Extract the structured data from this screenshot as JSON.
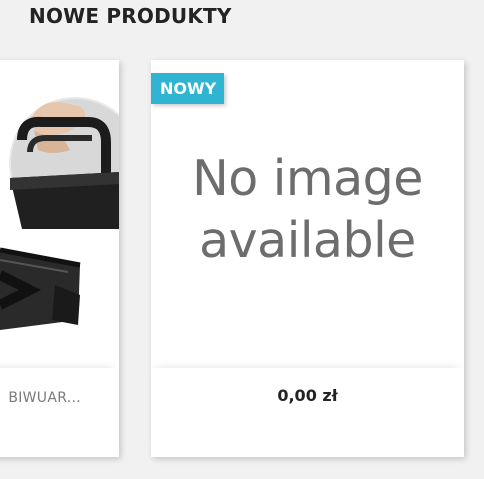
{
  "section": {
    "title": "NOWE PRODUKTY"
  },
  "products": [
    {
      "name": "BIWUAR...",
      "image_icon": "briefcase-bag-photo"
    },
    {
      "badge": "NOWY",
      "placeholder_line1": "No image",
      "placeholder_line2": "available",
      "price": "0,00 zł"
    }
  ],
  "colors": {
    "badge_background": "#2fb5d2",
    "page_background": "#f1f1f1",
    "card_background": "#ffffff"
  }
}
